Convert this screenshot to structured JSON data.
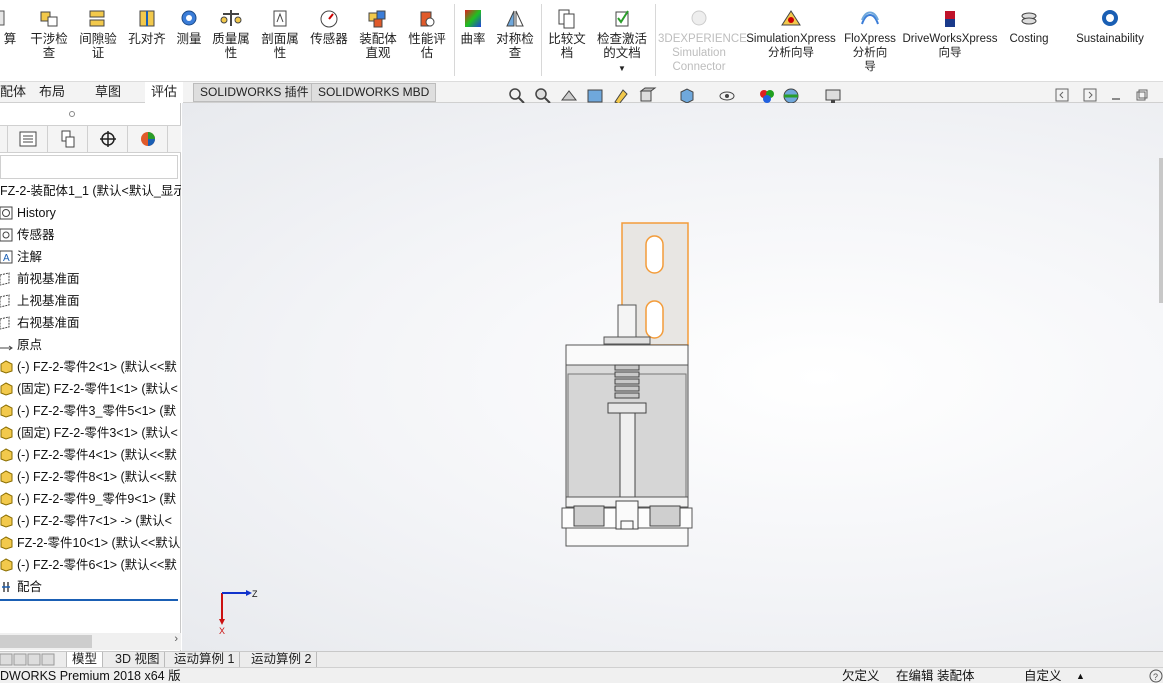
{
  "ribbon": {
    "items": [
      {
        "label1": "算",
        "label2": "",
        "icon": "calculate-icon"
      },
      {
        "label1": "干涉检",
        "label2": "查",
        "icon": "interference-icon"
      },
      {
        "label1": "间隙验",
        "label2": "证",
        "icon": "clearance-icon"
      },
      {
        "label1": "孔对齐",
        "label2": "",
        "icon": "hole-align-icon"
      },
      {
        "label1": "测量",
        "label2": "",
        "icon": "measure-icon"
      },
      {
        "label1": "质量属",
        "label2": "性",
        "icon": "mass-properties-icon"
      },
      {
        "label1": "剖面属",
        "label2": "性",
        "icon": "section-properties-icon"
      },
      {
        "label1": "传感器",
        "label2": "",
        "icon": "sensor-icon"
      },
      {
        "label1": "装配体",
        "label2": "直观",
        "icon": "assembly-visualization-icon"
      },
      {
        "label1": "性能评",
        "label2": "估",
        "icon": "performance-icon"
      },
      {
        "label1": "曲率",
        "label2": "",
        "icon": "curvature-icon"
      },
      {
        "label1": "对称检",
        "label2": "查",
        "icon": "symmetry-icon"
      },
      {
        "label1": "比较文",
        "label2": "档",
        "icon": "compare-icon"
      },
      {
        "label1": "检查激活",
        "label2": "的文档",
        "icon": "check-active-icon"
      },
      {
        "label1": "3DEXPERIENCE",
        "label2": "Simulation",
        "label3": "Connector",
        "icon": "3dx-icon"
      },
      {
        "label1": "SimulationXpress",
        "label2": "分析向导",
        "icon": "simxpress-icon"
      },
      {
        "label1": "FloXpress",
        "label2": "分析向",
        "label3": "导",
        "icon": "floxpress-icon"
      },
      {
        "label1": "DriveWorksXpress",
        "label2": "向导",
        "icon": "driveworks-icon"
      },
      {
        "label1": "Costing",
        "label2": "",
        "icon": "costing-icon"
      },
      {
        "label1": "Sustainability",
        "label2": "",
        "icon": "sustainability-icon"
      }
    ]
  },
  "tabs": [
    "配体",
    "布局",
    "草图",
    "评估",
    "SOLIDWORKS 插件",
    "SOLIDWORKS MBD"
  ],
  "tree": {
    "root": "FZ-2-装配体1_1 (默认<默认_显示",
    "items": [
      {
        "label": "History",
        "icon": "history-icon"
      },
      {
        "label": "传感器",
        "icon": "sensor-folder-icon"
      },
      {
        "label": "注解",
        "icon": "annotation-icon"
      },
      {
        "label": "前视基准面",
        "icon": "plane-icon"
      },
      {
        "label": "上视基准面",
        "icon": "plane-icon"
      },
      {
        "label": "右视基准面",
        "icon": "plane-icon"
      },
      {
        "label": "原点",
        "icon": "origin-icon"
      },
      {
        "label": "(-) FZ-2-零件2<1> (默认<<默",
        "icon": "part-icon"
      },
      {
        "label": "(固定) FZ-2-零件1<1> (默认<",
        "icon": "part-icon"
      },
      {
        "label": "(-) FZ-2-零件3_零件5<1> (默",
        "icon": "part-icon"
      },
      {
        "label": "(固定) FZ-2-零件3<1> (默认<",
        "icon": "part-icon"
      },
      {
        "label": "(-) FZ-2-零件4<1> (默认<<默",
        "icon": "part-icon"
      },
      {
        "label": "(-) FZ-2-零件8<1> (默认<<默",
        "icon": "part-icon"
      },
      {
        "label": "(-) FZ-2-零件9_零件9<1> (默",
        "icon": "part-icon"
      },
      {
        "label": "(-) FZ-2-零件7<1> -> (默认<",
        "icon": "part-icon"
      },
      {
        "label": "FZ-2-零件10<1> (默认<<默认",
        "icon": "part-icon"
      },
      {
        "label": "(-) FZ-2-零件6<1> (默认<<默",
        "icon": "part-icon"
      },
      {
        "label": "配合",
        "icon": "mates-icon"
      }
    ]
  },
  "triad": {
    "z": "Z",
    "x": "X"
  },
  "bottom_tabs": [
    "模型",
    "3D 视图",
    "运动算例 1",
    "运动算例 2"
  ],
  "status": {
    "app": "DWORKS Premium 2018 x64 版",
    "definition": "欠定义",
    "editing": "在编辑 装配体",
    "units": "自定义"
  },
  "colors": {
    "selection": "#f39c3a",
    "triad_x": "#cc1111",
    "triad_z": "#1133cc",
    "model_gray": "#d9d9d9"
  }
}
